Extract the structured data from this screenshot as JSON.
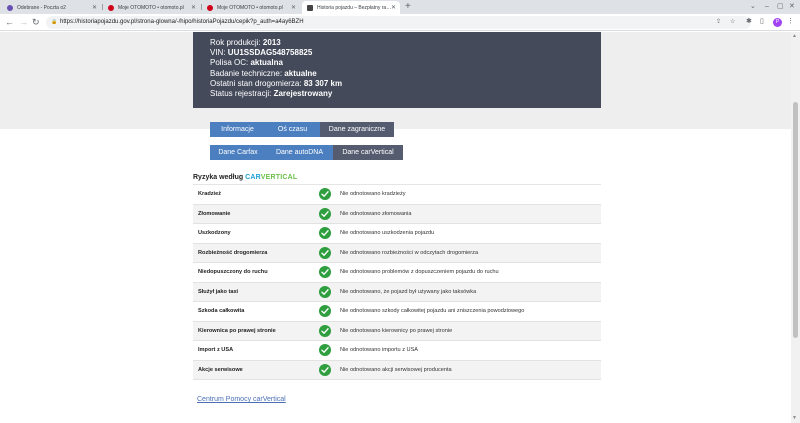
{
  "browser": {
    "tabs": [
      {
        "title": "Odebrane - Poczta o2",
        "favicon_color": "#6a4fb3",
        "active": false
      },
      {
        "title": "Moje OTOMOTO • otomoto.pl",
        "favicon_color": "#d0021b",
        "active": false
      },
      {
        "title": "Moje OTOMOTO • otomoto.pl",
        "favicon_color": "#d0021b",
        "active": false
      },
      {
        "title": "Historia pojazdu – Bezpłatny ra…",
        "favicon_color": "#444444",
        "active": true
      }
    ],
    "address": "https://historiapojazdu.gov.pl/strona-glowna/-/hipo/historiaPojazdu/cepik?p_auth=a4ay6BZH",
    "profile_initial": "P"
  },
  "vehicle": {
    "lines": [
      {
        "label": "Rok produkcji:",
        "value": "2013"
      },
      {
        "label": "VIN:",
        "value": "UU1SSDAG548758825"
      },
      {
        "label": "Polisa OC:",
        "value": "aktualna"
      },
      {
        "label": "Badanie techniczne:",
        "value": "aktualne"
      },
      {
        "label": "Ostatni stan drogomierza:",
        "value": "83 307 km"
      },
      {
        "label": "Status rejestracji:",
        "value": "Zarejestrowany"
      }
    ]
  },
  "tabs_row1": [
    "Informacje",
    "Oś czasu",
    "Dane zagraniczne"
  ],
  "tabs_row2": [
    "Dane Carfax",
    "Dane autoDNA",
    "Dane carVertical"
  ],
  "risk": {
    "title": "Ryzyka według",
    "brand_part1": "CAR",
    "brand_part2": "VERTICAL",
    "rows": [
      {
        "label": "Kradzież",
        "desc": "Nie odnotowano kradzieży"
      },
      {
        "label": "Złomowanie",
        "desc": "Nie odnotowano złomowania"
      },
      {
        "label": "Uszkodzony",
        "desc": "Nie odnotowano uszkodzenia pojazdu"
      },
      {
        "label": "Rozbieżność drogomierza",
        "desc": "Nie odnotowano rozbieżności w odczytach drogomierza"
      },
      {
        "label": "Niedopuszczony do ruchu",
        "desc": "Nie odnotowano problemów z dopuszczeniem pojazdu do ruchu"
      },
      {
        "label": "Służył jako taxi",
        "desc": "Nie odnotowano, że pojazd był używany jako taksówka"
      },
      {
        "label": "Szkoda całkowita",
        "desc": "Nie odnotowano szkody całkowitej pojazdu ani zniszczenia powodziowego"
      },
      {
        "label": "Kierownica po prawej stronie",
        "desc": "Nie odnotowano kierownicy po prawej stronie"
      },
      {
        "label": "Import z USA",
        "desc": "Nie odnotowano importu z USA"
      },
      {
        "label": "Akcje serwisowe",
        "desc": "Nie odnotowano akcji serwisowej producenta"
      }
    ]
  },
  "help_link": "Centrum Pomocy carVertical",
  "colors": {
    "hero": "#444a5a",
    "tab": "#4c7fc0",
    "tab_selected": "#555c6f",
    "check": "#2e9e3e"
  }
}
